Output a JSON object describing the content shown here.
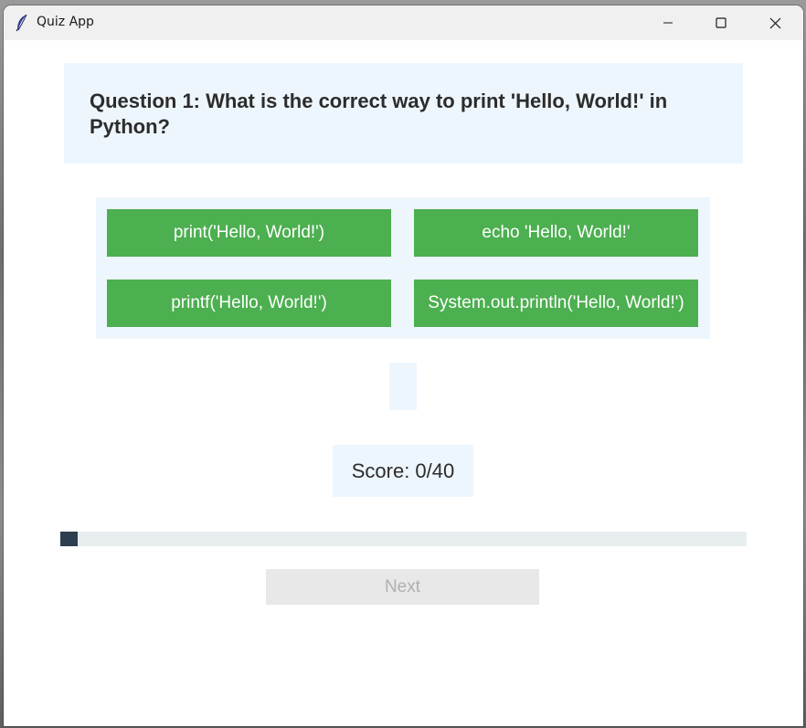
{
  "window": {
    "title": "Quiz App"
  },
  "question": {
    "text": "Question 1: What is the correct way to print 'Hello, World!' in Python?"
  },
  "options": [
    {
      "label": "print('Hello, World!')"
    },
    {
      "label": "echo 'Hello, World!'"
    },
    {
      "label": "printf('Hello, World!')"
    },
    {
      "label": "System.out.println('Hello, World!')"
    }
  ],
  "feedback": {
    "text": ""
  },
  "score": {
    "text": "Score: 0/40"
  },
  "progress": {
    "fraction": 0.025
  },
  "next": {
    "label": "Next",
    "enabled": false
  },
  "colors": {
    "option_bg": "#4caf50",
    "panel_bg": "#eef6fd",
    "progress_fill": "#2c3e50",
    "progress_track": "#e8eef0",
    "next_disabled_bg": "#e8e8e8",
    "next_disabled_text": "#b0b0b0"
  },
  "icons": {
    "app": "feather-icon",
    "minimize": "minimize-icon",
    "maximize": "maximize-icon",
    "close": "close-icon"
  }
}
